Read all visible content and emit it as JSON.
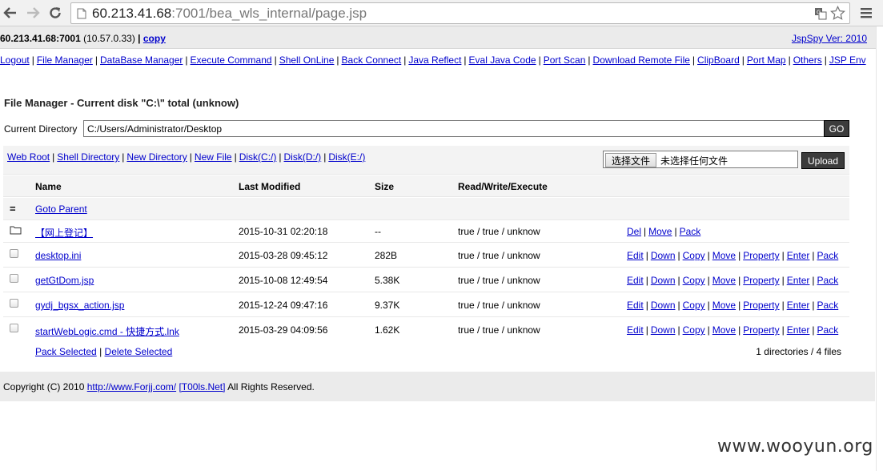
{
  "browser": {
    "url_host": "60.213.41.68",
    "url_rest": ":7001/bea_wls_internal/page.jsp"
  },
  "infobar": {
    "host": "60.213.41.68:7001",
    "internal_ip": "(10.57.0.33)",
    "sep": "|",
    "copy": "copy",
    "version": "JspSpy Ver: 2010"
  },
  "menu": {
    "items": [
      "Logout",
      "File Manager",
      "DataBase Manager",
      "Execute Command",
      "Shell OnLine",
      "Back Connect",
      "Java Reflect",
      "Eval Java Code",
      "Port Scan",
      "Download Remote File",
      "ClipBoard",
      "Port Map",
      "Others",
      "JSP Env"
    ],
    "sep": "|"
  },
  "title": "File Manager - Current disk \"C:\\\" total (unknow)",
  "curdir": {
    "label": "Current Directory",
    "value": "C:/Users/Administrator/Desktop",
    "go": "GO"
  },
  "toolbar": {
    "links": [
      "Web Root",
      "Shell Directory",
      "New Directory",
      "New File",
      "Disk(C:/)",
      "Disk(D:/)",
      "Disk(E:/)"
    ],
    "sep": "|",
    "choose": "选择文件",
    "no_file": "未选择任何文件",
    "upload": "Upload"
  },
  "table": {
    "headers": [
      "Name",
      "Last Modified",
      "Size",
      "Read/Write/Execute"
    ],
    "parent_icon": "=",
    "parent_label": "Goto Parent",
    "rows": [
      {
        "name": "【网上登记】",
        "modified": "2015-10-31 02:20:18",
        "size": "--",
        "rwx": "true / true / unknow",
        "actions": [
          "Del",
          "Move",
          "Pack"
        ],
        "icon": "folder-icon"
      },
      {
        "name": "desktop.ini",
        "modified": "2015-03-28 09:45:12",
        "size": "282B",
        "rwx": "true / true / unknow",
        "actions": [
          "Edit",
          "Down",
          "Copy",
          "Move",
          "Property",
          "Enter",
          "Pack"
        ],
        "icon": "checkbox"
      },
      {
        "name": "getGtDom.jsp",
        "modified": "2015-10-08 12:49:54",
        "size": "5.38K",
        "rwx": "true / true / unknow",
        "actions": [
          "Edit",
          "Down",
          "Copy",
          "Move",
          "Property",
          "Enter",
          "Pack"
        ],
        "icon": "checkbox"
      },
      {
        "name": "gydj_bgsx_action.jsp",
        "modified": "2015-12-24 09:47:16",
        "size": "9.37K",
        "rwx": "true / true / unknow",
        "actions": [
          "Edit",
          "Down",
          "Copy",
          "Move",
          "Property",
          "Enter",
          "Pack"
        ],
        "icon": "checkbox"
      },
      {
        "name": "startWebLogic.cmd - 快捷方式.lnk",
        "modified": "2015-03-29 04:09:56",
        "size": "1.62K",
        "rwx": "true / true / unknow",
        "actions": [
          "Edit",
          "Down",
          "Copy",
          "Move",
          "Property",
          "Enter",
          "Pack"
        ],
        "icon": "checkbox"
      }
    ],
    "pack_selected": "Pack Selected",
    "delete_selected": "Delete Selected",
    "bottom_sep": "|",
    "summary": "1 directories / 4 files"
  },
  "footer": {
    "text1": "Copyright (C) 2010",
    "link1": "http://www.Forjj.com/",
    "link2": "[T00ls.Net]",
    "text2": "All Rights Reserved."
  },
  "watermark": "www.wooyun.org"
}
